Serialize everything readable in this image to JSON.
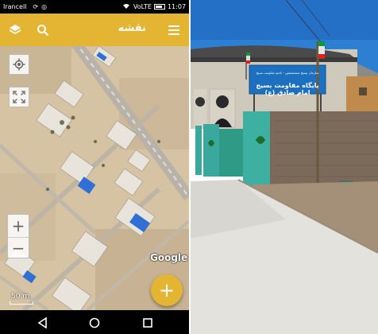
{
  "status_bar": {
    "carrier": "Irancell",
    "network": "VoLTE",
    "time": "11:07"
  },
  "toolbar": {
    "title": "نقشه",
    "layers_icon": "layers-icon",
    "search_icon": "search-icon",
    "menu_icon": "hamburger-menu-icon"
  },
  "map": {
    "attribution": "Google",
    "scale_label": "50 m",
    "zoom_in_label": "+",
    "zoom_out_label": "−",
    "locate_icon": "my-location-icon",
    "expand_icon": "fullscreen-icon",
    "fab_label": "+"
  },
  "nav_bar": {
    "back_icon": "back-triangle-icon",
    "home_icon": "home-circle-icon",
    "recent_icon": "recent-square-icon"
  },
  "photo": {
    "sign_small": "سازمان بسیج مستضعفین · ناحیه مقاومت بسیج",
    "sign_main": "پایگاه مقاومت بسیج امام صادق (ع)"
  },
  "colors": {
    "accent": "#e4b532",
    "sign_blue": "#1d6fc0",
    "wall_teal": "#3aa89c"
  }
}
